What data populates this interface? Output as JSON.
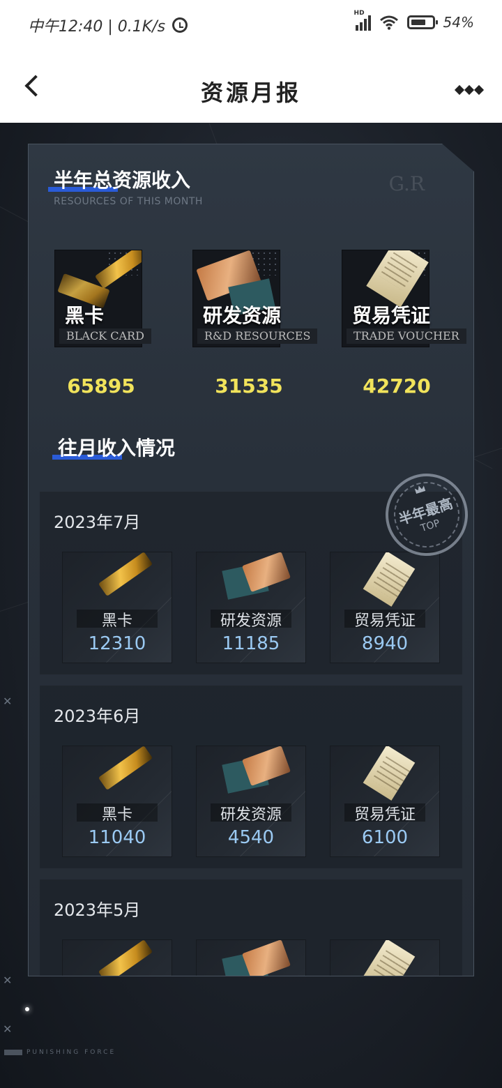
{
  "status_bar": {
    "time": "中午12:40 | 0.1K/s",
    "battery": "54%"
  },
  "nav": {
    "title": "资源月报"
  },
  "summary": {
    "title": "半年总资源收入",
    "subtitle": "RESOURCES OF THIS MONTH",
    "items": [
      {
        "cn": "黑卡",
        "en": "BLACK CARD",
        "value": "65895"
      },
      {
        "cn": "研发资源",
        "en": "R&D RESOURCES",
        "value": "31535"
      },
      {
        "cn": "贸易凭证",
        "en": "TRADE VOUCHER",
        "value": "42720"
      }
    ]
  },
  "history": {
    "title": "往月收入情况",
    "stamp": {
      "cn": "半年最高",
      "en": "TOP"
    },
    "months": [
      {
        "label": "2023年7月",
        "items": [
          {
            "name": "黑卡",
            "value": "12310"
          },
          {
            "name": "研发资源",
            "value": "11185"
          },
          {
            "name": "贸易凭证",
            "value": "8940"
          }
        ]
      },
      {
        "label": "2023年6月",
        "items": [
          {
            "name": "黑卡",
            "value": "11040"
          },
          {
            "name": "研发资源",
            "value": "4540"
          },
          {
            "name": "贸易凭证",
            "value": "6100"
          }
        ]
      },
      {
        "label": "2023年5月",
        "items": []
      }
    ]
  },
  "watermark": {
    "gr": "G.R",
    "footer": "PUNISHING FORCE"
  }
}
